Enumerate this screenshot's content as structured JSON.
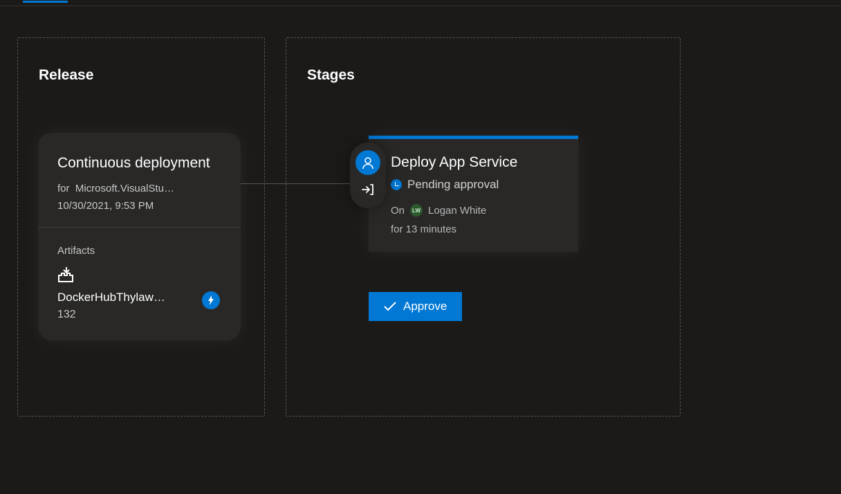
{
  "release": {
    "panel_title": "Release",
    "card": {
      "title": "Continuous deployment",
      "for_prefix": "for",
      "for_value": "Microsoft.VisualStu…",
      "datetime": "10/30/2021, 9:53 PM"
    },
    "artifacts": {
      "label": "Artifacts",
      "name": "DockerHubThylaw…",
      "build": "132"
    }
  },
  "stages": {
    "panel_title": "Stages",
    "stage": {
      "name": "Deploy App Service",
      "status": "Pending approval",
      "on_prefix": "On",
      "approver_initials": "LW",
      "approver_name": "Logan White",
      "duration": "for 13 minutes"
    },
    "approve_label": "Approve"
  }
}
